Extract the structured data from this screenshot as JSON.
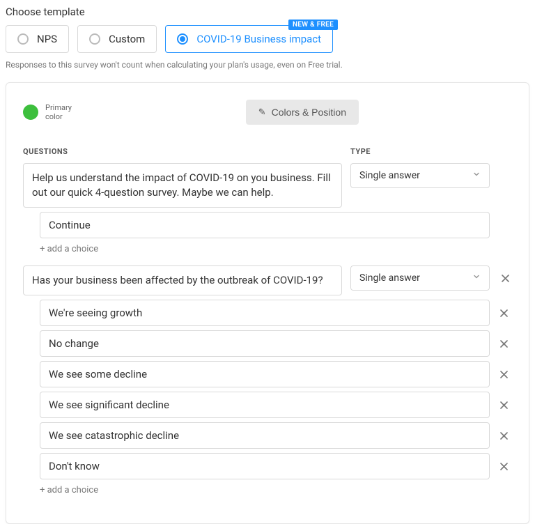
{
  "header": {
    "title": "Choose template",
    "templates": [
      {
        "label": "NPS",
        "selected": false,
        "badge": null
      },
      {
        "label": "Custom",
        "selected": false,
        "badge": null
      },
      {
        "label": "COVID-19 Business impact",
        "selected": true,
        "badge": "NEW & FREE"
      }
    ],
    "helper_text": "Responses to this survey won't count when calculating your plan's usage, even on Free trial."
  },
  "editor": {
    "primary_color_label": "Primary color",
    "primary_color": "#3DBF3D",
    "colors_position_label": "Colors & Position",
    "columns": {
      "questions": "QUESTIONS",
      "type": "TYPE"
    },
    "add_choice_label": "+ add a choice",
    "questions": [
      {
        "text": "Help us understand the impact of COVID-19 on you business. Fill out our quick 4-question survey. Maybe we can help.",
        "type": "Single answer",
        "deletable": false,
        "choices": [
          {
            "text": "Continue",
            "deletable": false
          }
        ]
      },
      {
        "text": "Has your business been affected by the outbreak of COVID-19?",
        "type": "Single answer",
        "deletable": true,
        "choices": [
          {
            "text": "We're seeing growth",
            "deletable": true
          },
          {
            "text": "No change",
            "deletable": true
          },
          {
            "text": "We see some decline",
            "deletable": true
          },
          {
            "text": "We see significant decline",
            "deletable": true
          },
          {
            "text": "We see catastrophic decline",
            "deletable": true
          },
          {
            "text": "Don't know",
            "deletable": true
          }
        ]
      }
    ]
  }
}
